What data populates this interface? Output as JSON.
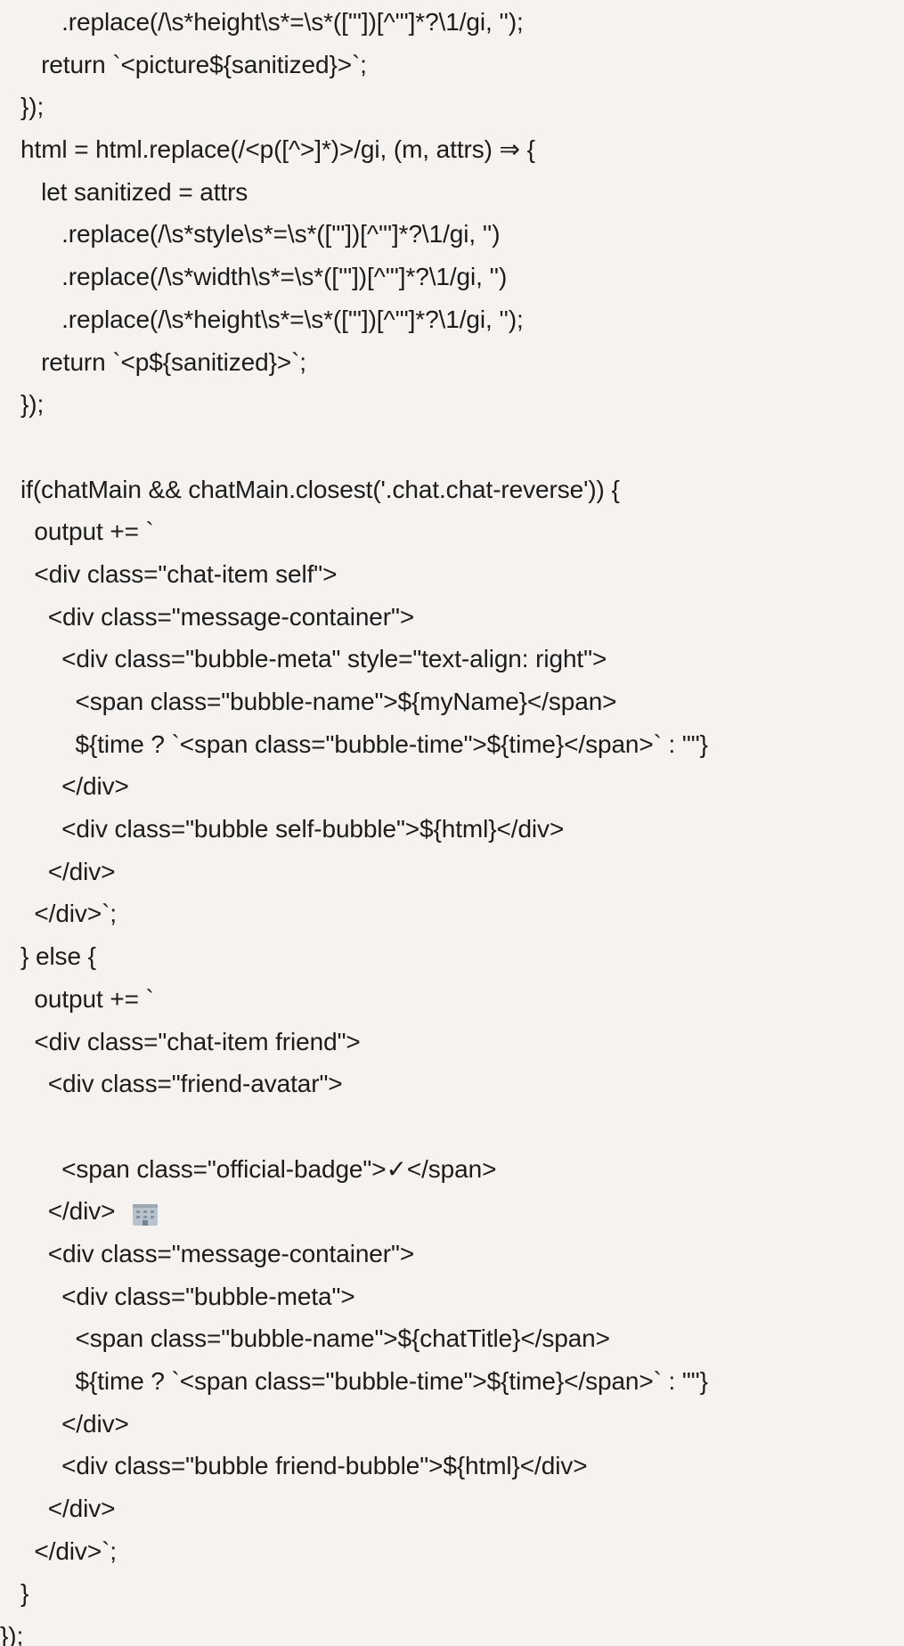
{
  "editor": {
    "lines": [
      "         .replace(/\\s*height\\s*=\\s*(['\"])[^'\"]*?\\1/gi, '');",
      "      return `<picture${sanitized}>`;",
      "   });",
      "   html = html.replace(/<p([^>]*)>/gi, (m, attrs) ⇒ {",
      "      let sanitized = attrs",
      "         .replace(/\\s*style\\s*=\\s*(['\"])[^'\"]*?\\1/gi, '')",
      "         .replace(/\\s*width\\s*=\\s*(['\"])[^'\"]*?\\1/gi, '')",
      "         .replace(/\\s*height\\s*=\\s*(['\"])[^'\"]*?\\1/gi, '');",
      "      return `<p${sanitized}>`;",
      "   });",
      "",
      "   if(chatMain && chatMain.closest('.chat.chat-reverse')) {",
      "     output += `",
      "     <div class=\"chat-item self\">",
      "       <div class=\"message-container\">",
      "         <div class=\"bubble-meta\" style=\"text-align: right\">",
      "           <span class=\"bubble-name\">${myName}</span>",
      "           ${time ? `<span class=\"bubble-time\">${time}</span>` : \"\"}",
      "         </div>",
      "         <div class=\"bubble self-bubble\">${html}</div>",
      "       </div>",
      "     </div>`;",
      "   } else {",
      "     output += `",
      "     <div class=\"chat-item friend\">",
      "       <div class=\"friend-avatar\">",
      "         ",
      "         <span class=\"official-badge\">✓</span>",
      "       </div>",
      "       <div class=\"message-container\">",
      "         <div class=\"bubble-meta\">",
      "           <span class=\"bubble-name\">${chatTitle}</span>",
      "           ${time ? `<span class=\"bubble-time\">${time}</span>` : \"\"}",
      "         </div>",
      "         <div class=\"bubble friend-bubble\">${html}</div>",
      "       </div>",
      "     </div>`;",
      "   }",
      "});"
    ],
    "icons": {
      "avatar_line_icon": "office-building-icon"
    }
  }
}
